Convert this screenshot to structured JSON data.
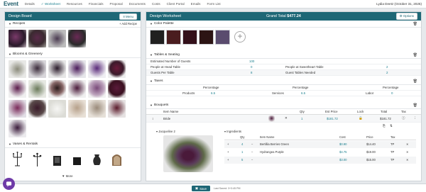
{
  "app": {
    "brand": "Event"
  },
  "nav": {
    "items": [
      "Details",
      "Worksheet",
      "Resources",
      "Financials",
      "Proposal",
      "Documents",
      "Costs",
      "Client Portal",
      "Emails",
      "Form List"
    ],
    "user": "Lydia Deetz (October 31, 2025)"
  },
  "left": {
    "title": "Design Board",
    "menu_label": "Menu",
    "recipes": {
      "label": "Recipes",
      "add_label": "+ Add Recipe"
    },
    "blooms": {
      "label": "Blooms & Greenery"
    },
    "vases": {
      "label": "Vases & Rentals"
    },
    "more_label": "More"
  },
  "right": {
    "title": "Design Worksheet",
    "grand_total_label": "Grand Total",
    "grand_total_value": "$477.24",
    "options_label": "Options",
    "color_palette": {
      "label": "Color Palette",
      "swatches": [
        "#202020",
        "#4a1d1f",
        "#33101a",
        "#2c1414",
        "#5a4c6e"
      ]
    },
    "tables": {
      "label": "Tables & Seating",
      "estimated_label": "Estimated Number of Guests",
      "estimated_value": "100",
      "head_table_label": "People at Head Table",
      "head_table_value": "0",
      "sweetheart_label": "People at Sweetheart Table",
      "sweetheart_value": "2",
      "guests_per_table_label": "Guests Per Table",
      "guests_per_table_value": "8",
      "tables_needed_label": "Guest Tables Needed",
      "tables_needed_value": "2"
    },
    "taxes": {
      "label": "Taxes",
      "percentage_label": "Percentage",
      "products_label": "Products",
      "products_value": "6.5",
      "services_label": "Services",
      "services_value": "6.5",
      "labor_label": "Labor",
      "labor_value": "0"
    },
    "bouquets": {
      "label": "Bouquets",
      "cols": {
        "item": "Item Name",
        "qty": "Qty",
        "price": "Est Price",
        "lock": "Lock",
        "total": "Total",
        "tax": "Tax"
      },
      "item": {
        "name": "Bride",
        "qty": "1",
        "price": "$181.72",
        "total": "$181.72",
        "tax": "TP"
      },
      "recipe_label": "Jacqueline 2",
      "ingredients": {
        "label": "Ingredients",
        "cols": {
          "qty": "Qty",
          "item": "Item Name",
          "cost": "Cost",
          "price": "Price",
          "tax": "Tax"
        },
        "rows": [
          {
            "qty": "4",
            "name": "Bertillia Berries Green",
            "cost": "$0.90",
            "price": "$14.40",
            "tax": "TP"
          },
          {
            "qty": "1",
            "name": "Hydrangea Purple",
            "cost": "$4.75",
            "price": "$19.00",
            "tax": "TP"
          },
          {
            "qty": "5",
            "name": "",
            "cost": "$3.00",
            "price": "$15.00",
            "tax": "TP"
          }
        ]
      }
    }
  },
  "footer": {
    "save_label": "Save",
    "last_saved": "Last Saved: 3+3:45 PM"
  }
}
